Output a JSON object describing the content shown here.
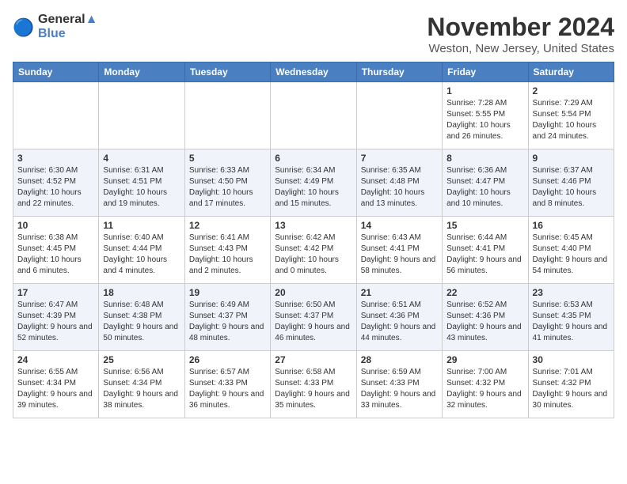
{
  "logo": {
    "line1": "General",
    "line2": "Blue"
  },
  "title": "November 2024",
  "subtitle": "Weston, New Jersey, United States",
  "days_of_week": [
    "Sunday",
    "Monday",
    "Tuesday",
    "Wednesday",
    "Thursday",
    "Friday",
    "Saturday"
  ],
  "weeks": [
    [
      {
        "day": "",
        "info": ""
      },
      {
        "day": "",
        "info": ""
      },
      {
        "day": "",
        "info": ""
      },
      {
        "day": "",
        "info": ""
      },
      {
        "day": "",
        "info": ""
      },
      {
        "day": "1",
        "info": "Sunrise: 7:28 AM\nSunset: 5:55 PM\nDaylight: 10 hours and 26 minutes."
      },
      {
        "day": "2",
        "info": "Sunrise: 7:29 AM\nSunset: 5:54 PM\nDaylight: 10 hours and 24 minutes."
      }
    ],
    [
      {
        "day": "3",
        "info": "Sunrise: 6:30 AM\nSunset: 4:52 PM\nDaylight: 10 hours and 22 minutes."
      },
      {
        "day": "4",
        "info": "Sunrise: 6:31 AM\nSunset: 4:51 PM\nDaylight: 10 hours and 19 minutes."
      },
      {
        "day": "5",
        "info": "Sunrise: 6:33 AM\nSunset: 4:50 PM\nDaylight: 10 hours and 17 minutes."
      },
      {
        "day": "6",
        "info": "Sunrise: 6:34 AM\nSunset: 4:49 PM\nDaylight: 10 hours and 15 minutes."
      },
      {
        "day": "7",
        "info": "Sunrise: 6:35 AM\nSunset: 4:48 PM\nDaylight: 10 hours and 13 minutes."
      },
      {
        "day": "8",
        "info": "Sunrise: 6:36 AM\nSunset: 4:47 PM\nDaylight: 10 hours and 10 minutes."
      },
      {
        "day": "9",
        "info": "Sunrise: 6:37 AM\nSunset: 4:46 PM\nDaylight: 10 hours and 8 minutes."
      }
    ],
    [
      {
        "day": "10",
        "info": "Sunrise: 6:38 AM\nSunset: 4:45 PM\nDaylight: 10 hours and 6 minutes."
      },
      {
        "day": "11",
        "info": "Sunrise: 6:40 AM\nSunset: 4:44 PM\nDaylight: 10 hours and 4 minutes."
      },
      {
        "day": "12",
        "info": "Sunrise: 6:41 AM\nSunset: 4:43 PM\nDaylight: 10 hours and 2 minutes."
      },
      {
        "day": "13",
        "info": "Sunrise: 6:42 AM\nSunset: 4:42 PM\nDaylight: 10 hours and 0 minutes."
      },
      {
        "day": "14",
        "info": "Sunrise: 6:43 AM\nSunset: 4:41 PM\nDaylight: 9 hours and 58 minutes."
      },
      {
        "day": "15",
        "info": "Sunrise: 6:44 AM\nSunset: 4:41 PM\nDaylight: 9 hours and 56 minutes."
      },
      {
        "day": "16",
        "info": "Sunrise: 6:45 AM\nSunset: 4:40 PM\nDaylight: 9 hours and 54 minutes."
      }
    ],
    [
      {
        "day": "17",
        "info": "Sunrise: 6:47 AM\nSunset: 4:39 PM\nDaylight: 9 hours and 52 minutes."
      },
      {
        "day": "18",
        "info": "Sunrise: 6:48 AM\nSunset: 4:38 PM\nDaylight: 9 hours and 50 minutes."
      },
      {
        "day": "19",
        "info": "Sunrise: 6:49 AM\nSunset: 4:37 PM\nDaylight: 9 hours and 48 minutes."
      },
      {
        "day": "20",
        "info": "Sunrise: 6:50 AM\nSunset: 4:37 PM\nDaylight: 9 hours and 46 minutes."
      },
      {
        "day": "21",
        "info": "Sunrise: 6:51 AM\nSunset: 4:36 PM\nDaylight: 9 hours and 44 minutes."
      },
      {
        "day": "22",
        "info": "Sunrise: 6:52 AM\nSunset: 4:36 PM\nDaylight: 9 hours and 43 minutes."
      },
      {
        "day": "23",
        "info": "Sunrise: 6:53 AM\nSunset: 4:35 PM\nDaylight: 9 hours and 41 minutes."
      }
    ],
    [
      {
        "day": "24",
        "info": "Sunrise: 6:55 AM\nSunset: 4:34 PM\nDaylight: 9 hours and 39 minutes."
      },
      {
        "day": "25",
        "info": "Sunrise: 6:56 AM\nSunset: 4:34 PM\nDaylight: 9 hours and 38 minutes."
      },
      {
        "day": "26",
        "info": "Sunrise: 6:57 AM\nSunset: 4:33 PM\nDaylight: 9 hours and 36 minutes."
      },
      {
        "day": "27",
        "info": "Sunrise: 6:58 AM\nSunset: 4:33 PM\nDaylight: 9 hours and 35 minutes."
      },
      {
        "day": "28",
        "info": "Sunrise: 6:59 AM\nSunset: 4:33 PM\nDaylight: 9 hours and 33 minutes."
      },
      {
        "day": "29",
        "info": "Sunrise: 7:00 AM\nSunset: 4:32 PM\nDaylight: 9 hours and 32 minutes."
      },
      {
        "day": "30",
        "info": "Sunrise: 7:01 AM\nSunset: 4:32 PM\nDaylight: 9 hours and 30 minutes."
      }
    ]
  ]
}
